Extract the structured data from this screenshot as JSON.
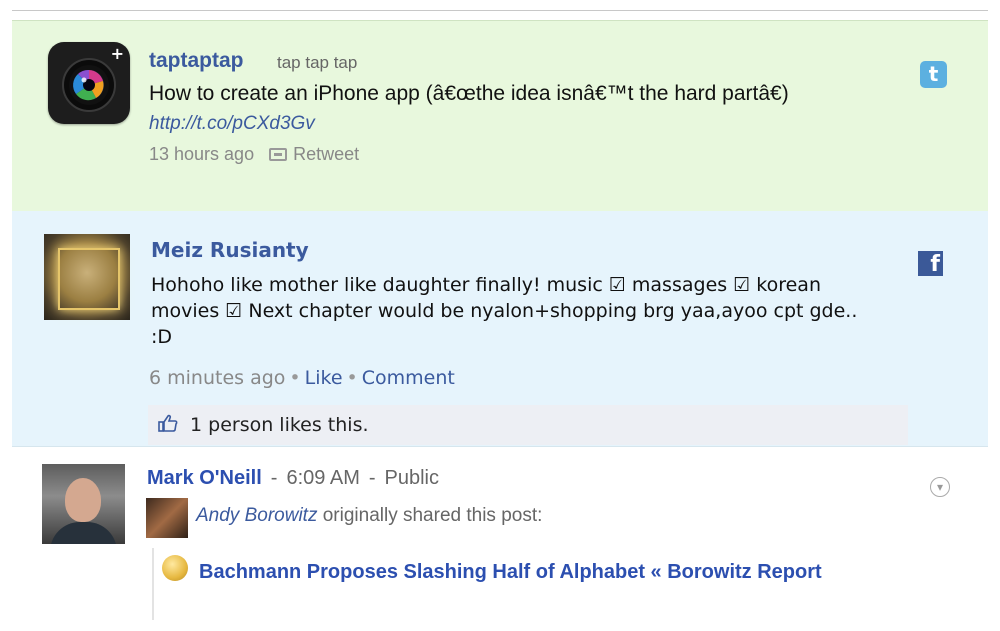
{
  "twitter_post": {
    "author": "taptaptap",
    "handle": "tap tap tap",
    "text": "How to create an iPhone app (â€œthe idea isnâ€™t the hard partâ€)",
    "link": "http://t.co/pCXd3Gv",
    "timestamp": "13 hours ago",
    "retweet_label": "Retweet",
    "service_logo": "t"
  },
  "facebook_post": {
    "author": "Meiz Rusianty",
    "text": "Hohoho like mother like daughter finally! music ☑ massages ☑ korean movies ☑ Next chapter would be nyalon+shopping brg yaa,ayoo cpt gde.. :D",
    "timestamp": "6 minutes ago",
    "like_label": "Like",
    "comment_label": "Comment",
    "likes_text": "1 person likes this.",
    "service_logo": "f"
  },
  "googleplus_post": {
    "author": "Mark O'Neill",
    "time": "6:09 AM",
    "visibility": "Public",
    "original_author": "Andy Borowitz",
    "shared_text": "originally shared this post:",
    "link_title": "Bachmann Proposes Slashing Half of Alphabet « Borowitz Report",
    "menu_glyph": "▾"
  },
  "colors": {
    "twitter_bg": "#e8f8dd",
    "facebook_bg": "#e6f4fc",
    "link_blue": "#3b5a9e"
  }
}
